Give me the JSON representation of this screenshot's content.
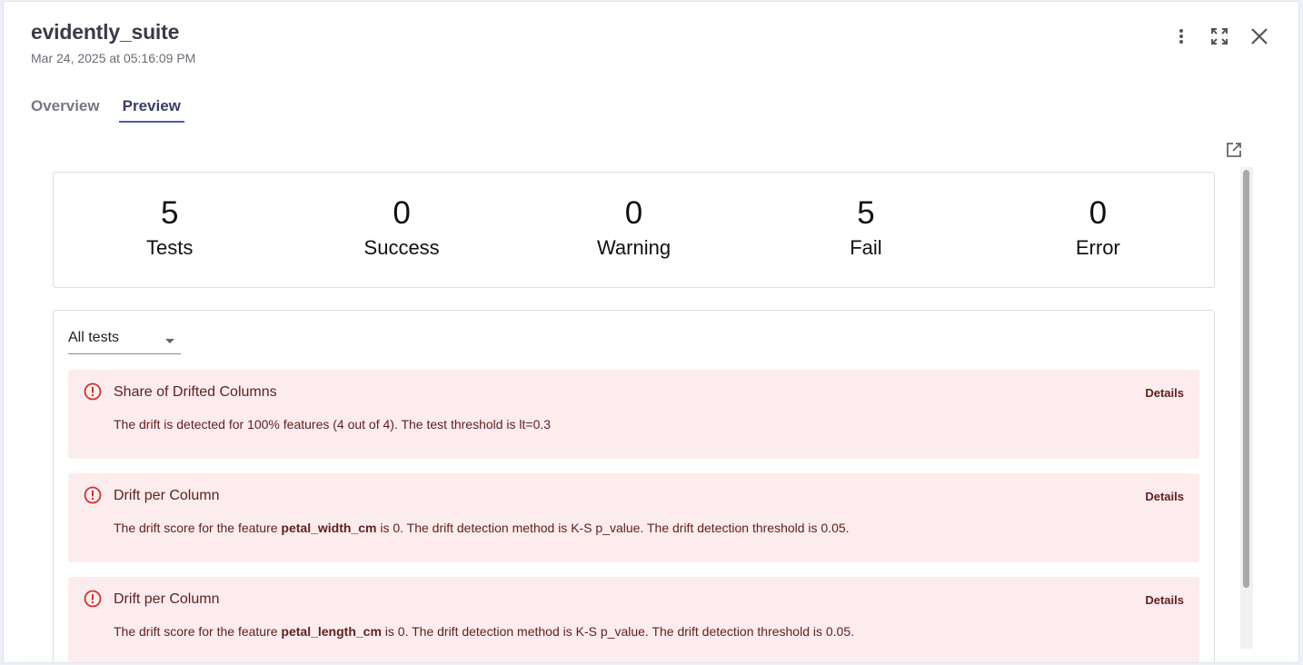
{
  "header": {
    "title": "evidently_suite",
    "subtitle": "Mar 24, 2025 at 05:16:09 PM"
  },
  "icons": {
    "more": "more-vertical-icon",
    "expand": "fullscreen-icon",
    "close": "close-icon",
    "external": "open-in-new-icon",
    "error": "error-outline-icon"
  },
  "tabs": [
    {
      "label": "Overview",
      "active": false
    },
    {
      "label": "Preview",
      "active": true
    }
  ],
  "summary": [
    {
      "count": "5",
      "label": "Tests"
    },
    {
      "count": "0",
      "label": "Success"
    },
    {
      "count": "0",
      "label": "Warning"
    },
    {
      "count": "5",
      "label": "Fail"
    },
    {
      "count": "0",
      "label": "Error"
    }
  ],
  "filter": {
    "selected": "All tests"
  },
  "tests": [
    {
      "title": "Share of Drifted Columns",
      "details_label": "Details",
      "desc_before": "The drift is detected for 100% features (4 out of 4). The test threshold is lt=0.3",
      "desc_bold": "",
      "desc_after": ""
    },
    {
      "title": "Drift per Column",
      "details_label": "Details",
      "desc_before": "The drift score for the feature ",
      "desc_bold": "petal_width_cm",
      "desc_after": " is 0. The drift detection method is K-S p_value. The drift detection threshold is 0.05."
    },
    {
      "title": "Drift per Column",
      "details_label": "Details",
      "desc_before": "The drift score for the feature ",
      "desc_bold": "petal_length_cm",
      "desc_after": " is 0. The drift detection method is K-S p_value. The drift detection threshold is 0.05."
    }
  ],
  "colors": {
    "accent": "#4a5bbf",
    "fail_bg": "#fdeced",
    "fail_text": "#5f2120",
    "fail_icon": "#d32f2f"
  }
}
